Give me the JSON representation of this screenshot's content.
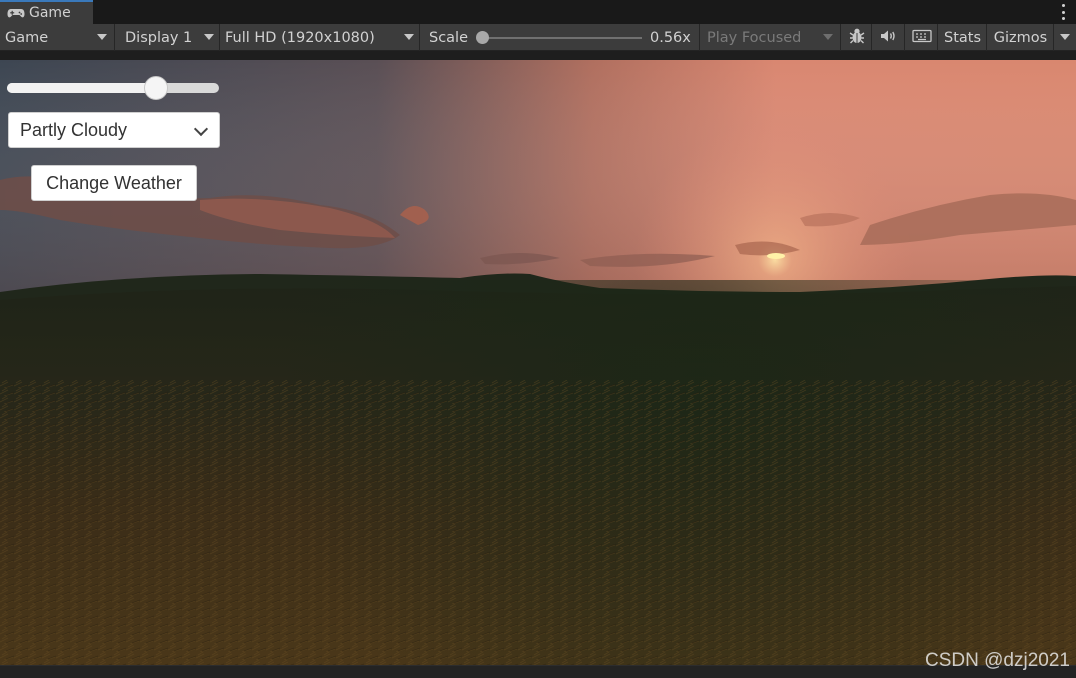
{
  "window": {
    "tab_title": "Game"
  },
  "toolbar": {
    "view_mode": "Game",
    "display": "Display 1",
    "resolution": "Full HD (1920x1080)",
    "scale_label": "Scale",
    "scale_value": "0.56x",
    "play_mode": "Play Focused",
    "stats_label": "Stats",
    "gizmos_label": "Gizmos"
  },
  "game_ui": {
    "slider_value_fraction": 0.73,
    "weather_dropdown": {
      "selected": "Partly Cloudy"
    },
    "change_weather_label": "Change Weather"
  },
  "watermark": "CSDN @dzj2021",
  "icons": [
    "gamepad-icon",
    "more-options-icon",
    "dropdown-arrow-icon",
    "bug-icon",
    "speaker-icon",
    "keyboard-icon",
    "chevron-down-icon"
  ]
}
